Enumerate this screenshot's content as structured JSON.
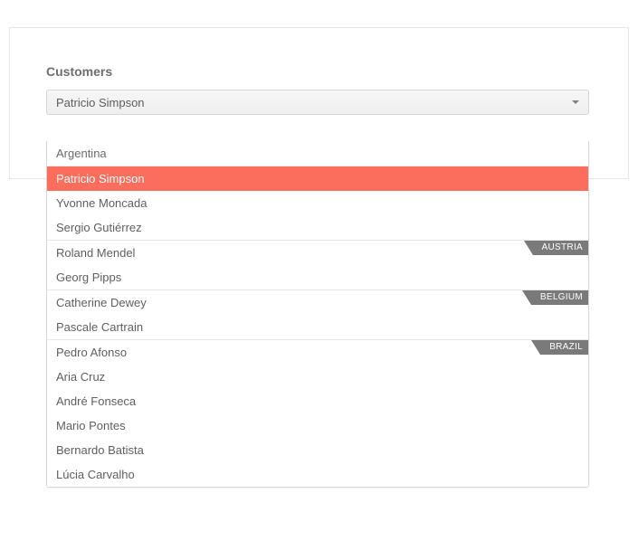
{
  "section": {
    "label": "Customers"
  },
  "dropdown": {
    "selected": "Patricio Simpson",
    "groups": [
      {
        "label": "Argentina",
        "style": "plain",
        "items": [
          {
            "label": "Patricio Simpson",
            "selected": true
          },
          {
            "label": "Yvonne Moncada"
          },
          {
            "label": "Sergio Gutiérrez"
          }
        ]
      },
      {
        "label": "AUSTRIA",
        "style": "tag",
        "items": [
          {
            "label": "Roland Mendel"
          },
          {
            "label": "Georg Pipps"
          }
        ]
      },
      {
        "label": "BELGIUM",
        "style": "tag",
        "items": [
          {
            "label": "Catherine Dewey"
          },
          {
            "label": "Pascale Cartrain"
          }
        ]
      },
      {
        "label": "BRAZIL",
        "style": "tag",
        "items": [
          {
            "label": "Pedro Afonso"
          },
          {
            "label": "Aria Cruz"
          },
          {
            "label": "André Fonseca"
          },
          {
            "label": "Mario Pontes"
          },
          {
            "label": "Bernardo Batista"
          },
          {
            "label": "Lúcia Carvalho"
          }
        ]
      }
    ]
  },
  "colors": {
    "highlight": "#fb6e5d"
  }
}
